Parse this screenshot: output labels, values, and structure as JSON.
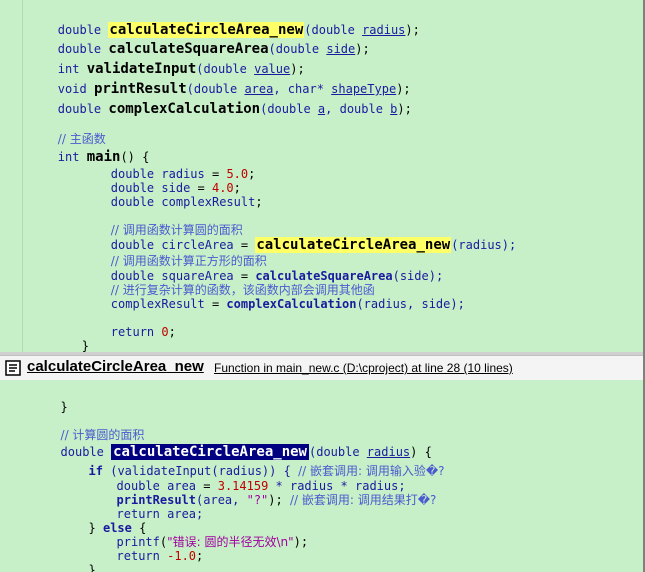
{
  "editor": {
    "l1": {
      "type": "double",
      "fn": "calculateCircleArea_new",
      "open": "(double ",
      "p1": "radius",
      "close": ");"
    },
    "l2": {
      "type": "double",
      "fn": "calculateSquareArea",
      "open": "(double ",
      "p1": "side",
      "close": ");"
    },
    "l3": {
      "type": "int",
      "fn": "validateInput",
      "open": "(double ",
      "p1": "value",
      "close": ");"
    },
    "l4": {
      "type": "void",
      "fn": "printResult",
      "open": "(double ",
      "p1": "area",
      "mid": ", char* ",
      "p2": "shapeType",
      "close": ");"
    },
    "l5": {
      "type": "double",
      "fn": "complexCalculation",
      "open": "(double ",
      "p1": "a",
      "mid": ", double ",
      "p2": "b",
      "close": ");"
    },
    "c_main": "// 主函数",
    "main_type": "int",
    "main_fn": "main",
    "main_rest": "() {",
    "d1": {
      "type": "double",
      "name": "radius",
      "eq": " = ",
      "val": "5.0",
      "end": ";"
    },
    "d2": {
      "type": "double",
      "name": "side",
      "eq": " = ",
      "val": "4.0",
      "end": ";"
    },
    "d3": {
      "type": "double",
      "name": "complexResult",
      "end": ";"
    },
    "c1": "// 调用函数计算圆的面积",
    "s1": {
      "type": "double",
      "name": "circleArea",
      "eq": " = ",
      "call": "calculateCircleArea_new",
      "args": "(radius);"
    },
    "c2": "// 调用函数计算正方形的面积",
    "s2": {
      "type": "double",
      "name": "squareArea",
      "eq": " = ",
      "call": "calculateSquareArea",
      "args": "(side);"
    },
    "c3": "// 进行复杂计算的函数，该函数内部会调用其他函",
    "s3": {
      "name": "complexResult",
      "eq": " = ",
      "call": "complexCalculation",
      "args": "(radius, side);"
    },
    "ret_kw": "return",
    "ret_val": "0",
    "ret_end": ";",
    "close_brace": "}"
  },
  "peek": {
    "title": "calculateCircleArea_new",
    "info": "Function in main_new.c (D:\\cproject) at line 28 (10 lines)",
    "p0": "}",
    "pc": "// 计算圆的面积",
    "pdef_type": "double",
    "pdef_fn": "calculateCircleArea_new",
    "pdef_open": "(double ",
    "pdef_p": "radius",
    "pdef_close": ") {",
    "if_kw": "if",
    "if_open": " (",
    "if_call": "validateInput",
    "if_args": "(radius)) {",
    "if_cm": "// 嵌套调用: 调用输入验�?",
    "a_type": "double",
    "a_name": "area",
    "a_eq": " = ",
    "a_num": "3.14159",
    "a_rest": " * radius * radius;",
    "pr_fn": "printResult",
    "pr_open": "(area, ",
    "pr_str": "\"?\"",
    "pr_close": ");",
    "pr_cm": "// 嵌套调用: 调用结果打�?",
    "r1_kw": "return",
    "r1_val": " area;",
    "else_open": "} ",
    "else_kw": "else",
    "else_brace": " {",
    "pf_fn": "printf",
    "pf_open": "(",
    "pf_str": "\"错误: 圆的半径无效\\n\"",
    "pf_close": ");",
    "r2_kw": "return",
    "r2_val": "-1.0",
    "r2_end": ";",
    "inner_close": "}",
    "outer_close": "}"
  }
}
